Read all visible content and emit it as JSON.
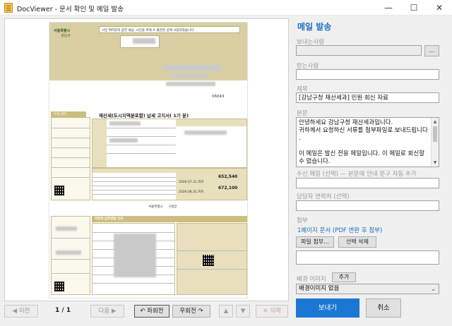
{
  "window": {
    "title": "DocViewer - 문서 확인 및 메일 발송",
    "minimize": "—",
    "maximize": "☐",
    "close": "✕"
  },
  "preview": {
    "doc": {
      "notice_line": "시민 여러분의 값진 세금, 시민을 위해 쓰 혈감된 곳에 사용되었습니다.",
      "issuer": "서울특별시",
      "district": "강남구",
      "postcode": "06043",
      "title": "재산세(도시지역분포함) 납세 고지서( 1기 분)",
      "due1": "2026.07.31.까지",
      "amount1": "652,540",
      "amount2": "672,100",
      "due2": "2026.08.31.까지",
      "bottom_title": "지방세 납부방법 안내",
      "issuer_bottom": "서울특별시",
      "issuer_bottom2": "구청장",
      "section_left": "부과 내역"
    },
    "nav": {
      "prev": "◀ 이전",
      "page": "1 / 1",
      "next": "다음 ▶",
      "rotate_left": "↶ 좌회전",
      "rotate_right": "우회전 ↷",
      "up": "▲",
      "down": "▼",
      "delete": "✕ 삭제"
    }
  },
  "form": {
    "panel_title": "메일 발송",
    "sender_label": "보내는사람",
    "sender_value": "",
    "sender_btn": "…",
    "recipient_label": "받는사람",
    "recipient_value": "",
    "subject_label": "제목",
    "subject_value": "[강남구청 재산세과] 민원 회신 자료",
    "body_label": "본문",
    "body_lines": [
      "안녕하세요 강남구청 재산세과입니다.",
      "귀하께서 요청하신 서류를 첨부파일로 보내드립니다",
      ".",
      "",
      "이 메일은 발신 전용 메일입니다. 이 메일로 회신할",
      "수 없습니다."
    ],
    "recv_label": "수신 메일 (선택) — 본문에 안내 문구 자동 추가",
    "recv_value": "",
    "contact_label": "담당자 연락처 (선택)",
    "contact_value": "",
    "attach_label": "첨부",
    "attach_text": "1페이지 문서 (PDF 변환 후 첨부)",
    "attach_file_btn": "파일 첨부...",
    "attach_delete_btn": "선택 삭제",
    "bg_label": "배경 이미지",
    "bg_add_btn": "추가",
    "bg_selected": "배경이미지 없음",
    "send_btn": "보내기",
    "cancel_btn": "취소"
  },
  "colors": {
    "accent": "#1f6fc0",
    "send_button": "#1a78d4",
    "doc_tan": "#d9cfa3"
  }
}
